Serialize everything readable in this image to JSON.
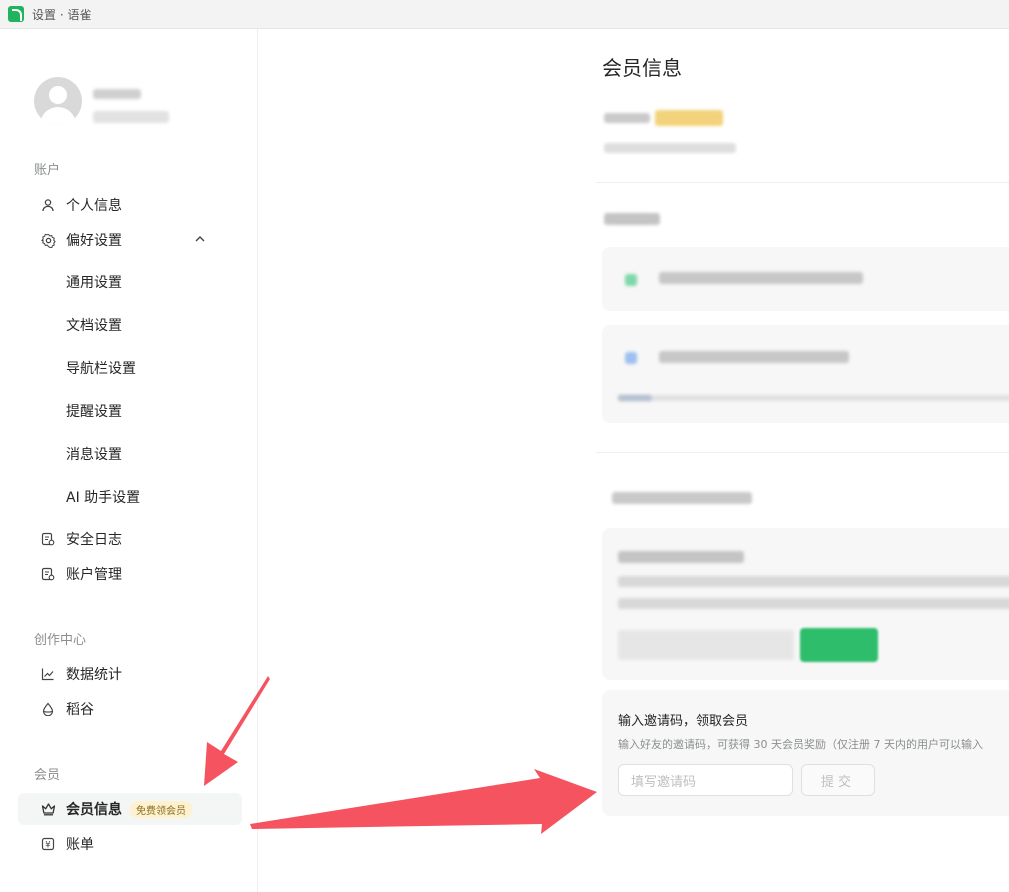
{
  "window": {
    "title": "设置 · 语雀"
  },
  "sidebar": {
    "sections": {
      "account": "账户",
      "creation": "创作中心",
      "member": "会员"
    },
    "items": {
      "profile": "个人信息",
      "preferences": "偏好设置",
      "general": "通用设置",
      "document": "文档设置",
      "navbar": "导航栏设置",
      "reminder": "提醒设置",
      "message": "消息设置",
      "ai": "AI 助手设置",
      "security_log": "安全日志",
      "account_mgmt": "账户管理",
      "stats": "数据统计",
      "daogu": "稻谷",
      "member_info": "会员信息",
      "member_badge": "免费领会员",
      "bill": "账单"
    }
  },
  "main": {
    "title": "会员信息",
    "invite": {
      "title": "输入邀请码，领取会员",
      "description": "输入好友的邀请码，可获得 30 天会员奖励（仅注册 7 天内的用户可以输入",
      "placeholder": "填写邀请码",
      "submit": "提交"
    }
  },
  "colors": {
    "brand_green": "#22b35e",
    "annotation_red": "#f5535f",
    "badge_bg": "#fdf1cf"
  }
}
